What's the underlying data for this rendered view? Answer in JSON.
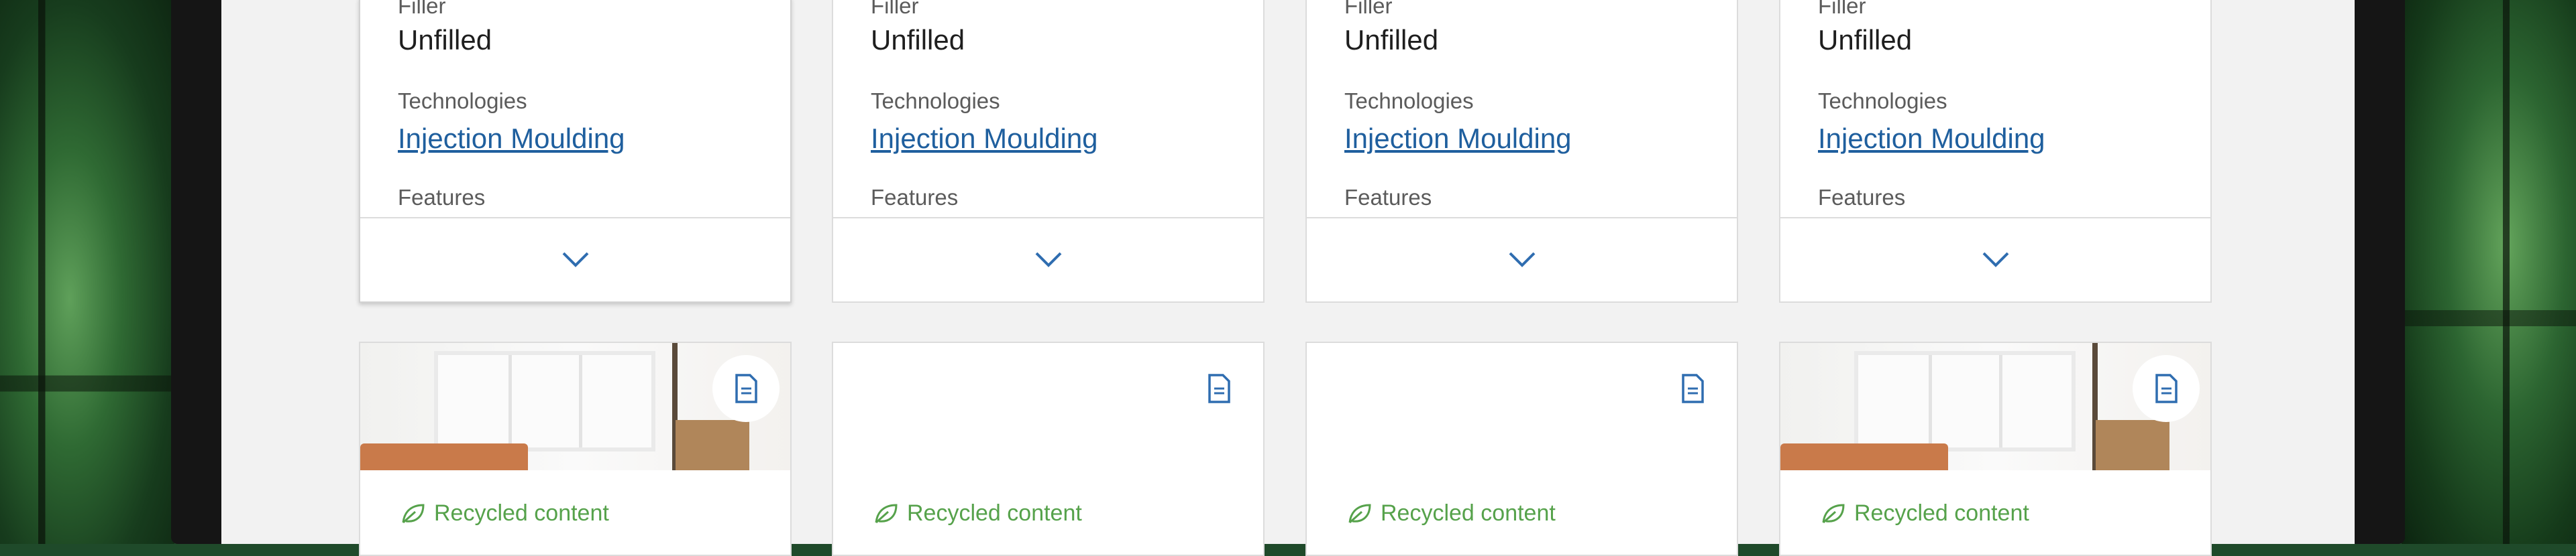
{
  "cards_top": [
    {
      "filler_label": "Filler",
      "filler_value": "Unfilled",
      "tech_label": "Technologies",
      "tech_value": "Injection Moulding",
      "features_label": "Features"
    },
    {
      "filler_label": "Filler",
      "filler_value": "Unfilled",
      "tech_label": "Technologies",
      "tech_value": "Injection Moulding",
      "features_label": "Features"
    },
    {
      "filler_label": "Filler",
      "filler_value": "Unfilled",
      "tech_label": "Technologies",
      "tech_value": "Injection Moulding",
      "features_label": "Features"
    },
    {
      "filler_label": "Filler",
      "filler_value": "Unfilled",
      "tech_label": "Technologies",
      "tech_value": "Injection Moulding",
      "features_label": "Features"
    }
  ],
  "cards_bottom": [
    {
      "badge": "Recycled content",
      "has_image": true,
      "icon": "document-icon"
    },
    {
      "badge": "Recycled content",
      "has_image": false,
      "icon": "document-icon"
    },
    {
      "badge": "Recycled content",
      "has_image": false,
      "icon": "document-icon"
    },
    {
      "badge": "Recycled content",
      "has_image": true,
      "icon": "document-icon"
    }
  ],
  "colors": {
    "link": "#1f5f9e",
    "accent_green": "#56a24b",
    "chevron": "#2f6db0"
  },
  "icons": {
    "expand": "chevron-down-icon",
    "badge": "leaf-icon"
  }
}
